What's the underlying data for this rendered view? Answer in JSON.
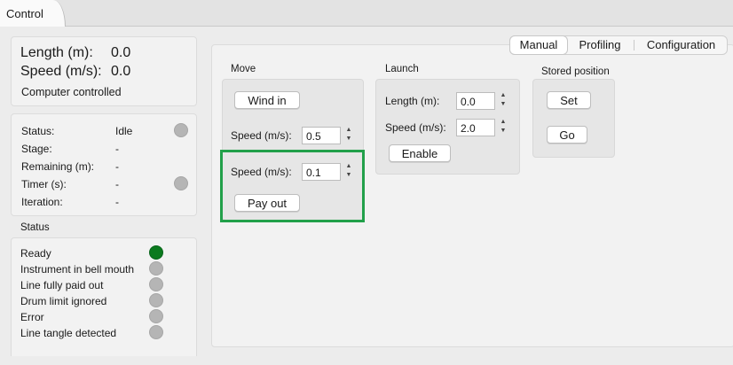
{
  "tabs": {
    "control": "Control"
  },
  "readout": {
    "length_label": "Length (m):",
    "length_value": "0.0",
    "speed_label": "Speed (m/s):",
    "speed_value": "0.0",
    "mode": "Computer controlled"
  },
  "status_panel": {
    "status_label": "Status:",
    "status_value": "Idle",
    "stage_label": "Stage:",
    "stage_value": "-",
    "remaining_label": "Remaining (m):",
    "remaining_value": "-",
    "timer_label": "Timer (s):",
    "timer_value": "-",
    "iteration_label": "Iteration:",
    "iteration_value": "-"
  },
  "flags": {
    "title": "Status",
    "items": [
      {
        "label": "Ready",
        "color": "#0b7a1e"
      },
      {
        "label": "Instrument in bell mouth",
        "color": "#b5b5b5"
      },
      {
        "label": "Line fully paid out",
        "color": "#b5b5b5"
      },
      {
        "label": "Drum limit ignored",
        "color": "#b5b5b5"
      },
      {
        "label": "Error",
        "color": "#b5b5b5"
      },
      {
        "label": "Line tangle detected",
        "color": "#b5b5b5"
      }
    ]
  },
  "mode_tabs": [
    "Manual",
    "Profiling",
    "Configuration"
  ],
  "mode_tab_selected": "Manual",
  "move": {
    "title": "Move",
    "wind_in_button": "Wind in",
    "wind_speed_label": "Speed (m/s):",
    "wind_speed_value": "0.5",
    "pay_speed_label": "Speed (m/s):",
    "pay_speed_value": "0.1",
    "pay_out_button": "Pay out"
  },
  "launch": {
    "title": "Launch",
    "length_label": "Length (m):",
    "length_value": "0.0",
    "speed_label": "Speed (m/s):",
    "speed_value": "2.0",
    "enable_button": "Enable"
  },
  "stored_position": {
    "title": "Stored position",
    "set_button": "Set",
    "go_button": "Go"
  },
  "colors": {
    "highlight": "#22a04a",
    "ready": "#0b7a1e",
    "idle_dot": "#b5b5b5"
  }
}
